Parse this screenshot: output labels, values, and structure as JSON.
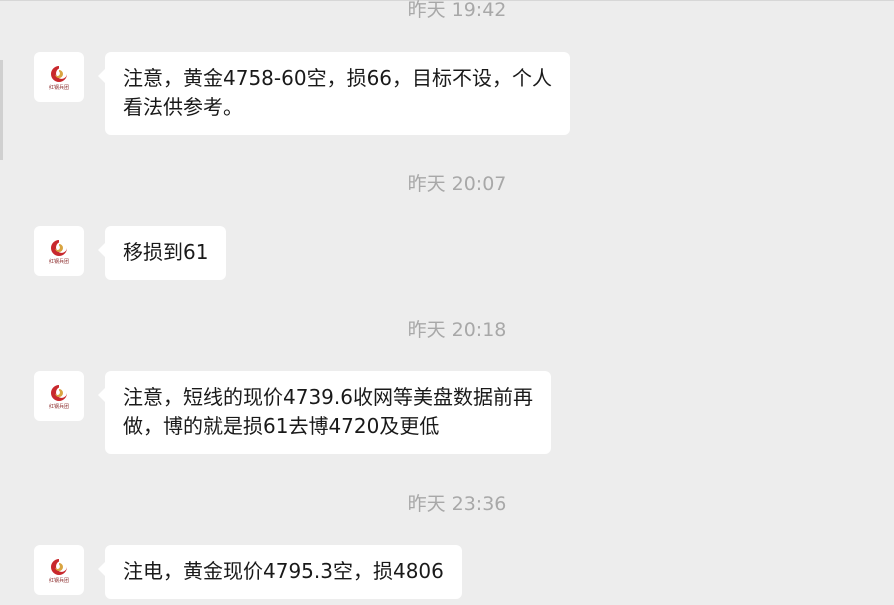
{
  "avatar": {
    "brand_text": "红钢兵团",
    "logo": "red-swirl-logo",
    "colors": {
      "red": "#c8282d",
      "gold": "#d9a441"
    }
  },
  "messages": [
    {
      "timestamp": "昨天 19:42",
      "lines": [
        "注意，黄金4758-60空，损66，目标不设，个人",
        "看法供参考。"
      ]
    },
    {
      "timestamp": "昨天 20:07",
      "lines": [
        "移损到61"
      ]
    },
    {
      "timestamp": "昨天 20:18",
      "lines": [
        "注意，短线的现价4739.6收网等美盘数据前再",
        "做，博的就是损61去博4720及更低"
      ]
    },
    {
      "timestamp": "昨天 23:36",
      "lines": [
        "注电，黄金现价4795.3空，损4806"
      ]
    }
  ]
}
